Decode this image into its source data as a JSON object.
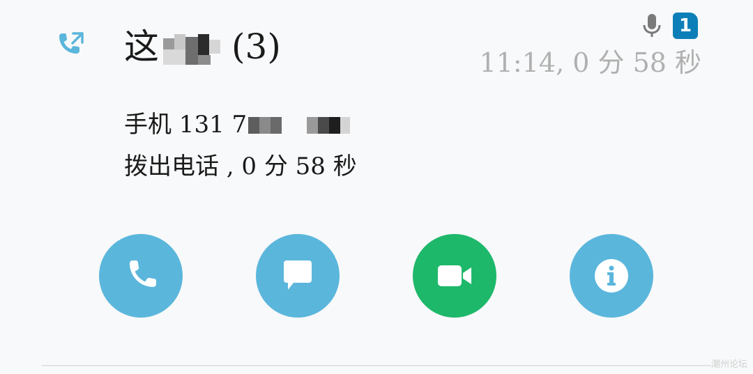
{
  "notification": {
    "contact_prefix": "这",
    "contact_count": "(3)",
    "time_text": "11:14, 0 分 58 秒",
    "sim_number": "1",
    "phone_prefix": "手机 131 7",
    "call_summary": "拨出电话 , 0 分 58 秒"
  },
  "icons": {
    "call_type": "outgoing-call-icon",
    "mic": "microphone-icon",
    "sim": "sim-1-badge"
  },
  "actions": [
    {
      "name": "call",
      "icon": "phone-icon",
      "color": "#5bb6dc"
    },
    {
      "name": "message",
      "icon": "message-bubble-icon",
      "color": "#5bb6dc"
    },
    {
      "name": "video-call",
      "icon": "video-camera-icon",
      "color": "#1eb86b"
    },
    {
      "name": "info",
      "icon": "info-icon",
      "color": "#5bb6dc"
    }
  ],
  "colors": {
    "accent_blue": "#5bb6dc",
    "accent_green": "#1eb86b",
    "sim_badge": "#0d7fb8",
    "muted_text": "#b0b0b0"
  },
  "watermark": "潮州论坛"
}
